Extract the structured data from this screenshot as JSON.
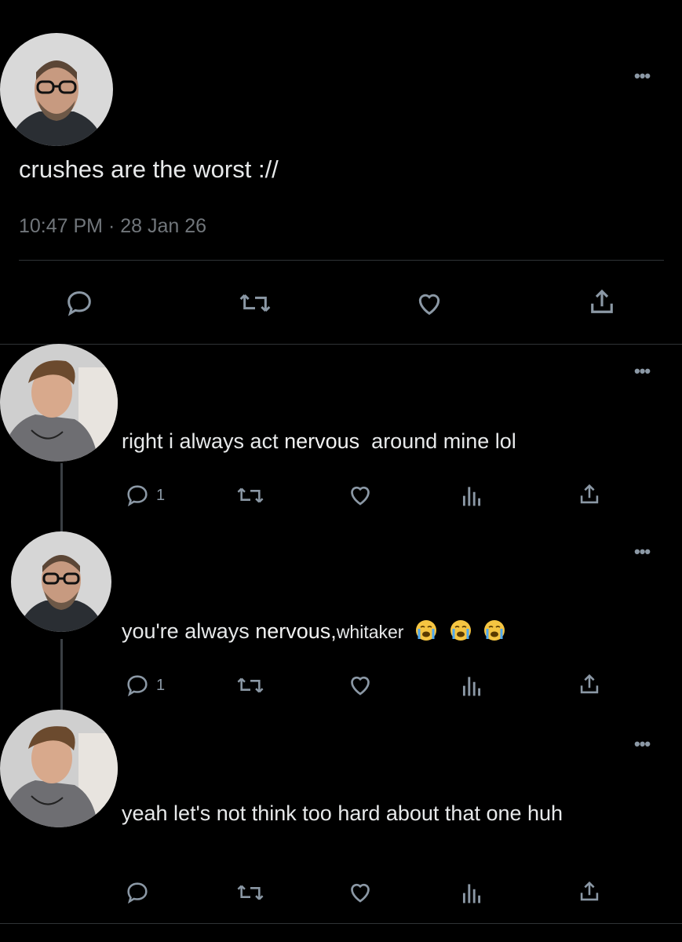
{
  "main_tweet": {
    "text": "crushes are the worst ://",
    "timestamp": "10:47 PM · 28 Jan 26"
  },
  "replies": [
    {
      "text_before": "right i always act",
      "highlight": "nervous",
      "text_after": "around mine lol",
      "reply_count": "1"
    },
    {
      "text_before": "you're always",
      "highlight": "nervous,",
      "text_after": "whitaker",
      "emojis": [
        "loudly-crying-face",
        "loudly-crying-face",
        "loudly-crying-face"
      ],
      "reply_count": "1"
    },
    {
      "text": "yeah let's not think too hard about that one huh"
    }
  ],
  "colors": {
    "background": "#000000",
    "text": "#e7e9ea",
    "secondary": "#71767b",
    "icon": "#8b98a5",
    "divider": "#2f3336"
  },
  "icons": [
    "more-icon",
    "reply-icon",
    "retweet-icon",
    "like-icon",
    "share-icon",
    "views-icon"
  ]
}
